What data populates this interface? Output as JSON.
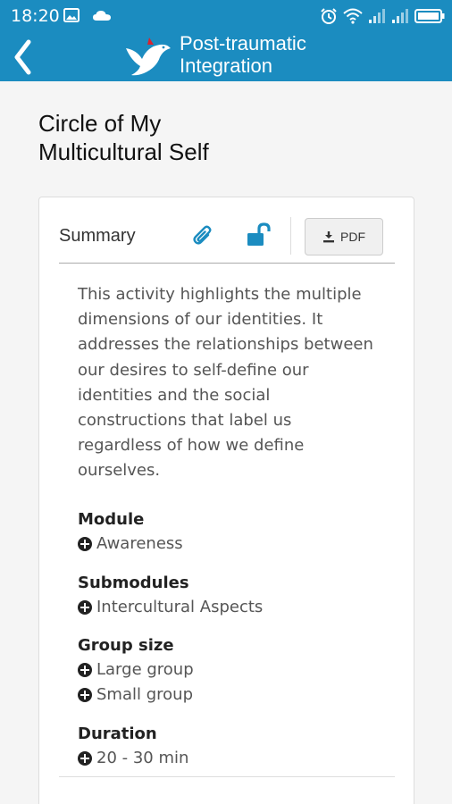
{
  "status_bar": {
    "time": "18:20",
    "icons": [
      "image-icon",
      "cloud-icon",
      "alarm-icon",
      "wifi-icon",
      "signal-icon",
      "signal-icon",
      "battery-icon"
    ]
  },
  "app_header": {
    "brand_line1": "Post-traumatic",
    "brand_line2": "Integration",
    "back_icon": "chevron-left-icon",
    "logo": "bird-logo",
    "color": "#1b8cc0"
  },
  "page": {
    "title_line1": "Circle of My",
    "title_line2": "Multicultural Self"
  },
  "card": {
    "summary_label": "Summary",
    "pdf_label": "PDF",
    "description": "This activity highlights the multiple dimensions of our identities. It addresses the relationships between our desires to self-define our identities and the social constructions that label us regardless of how we define ourselves.",
    "sections": [
      {
        "title": "Module",
        "items": [
          "Awareness"
        ]
      },
      {
        "title": "Submodules",
        "items": [
          "Intercultural Aspects"
        ]
      },
      {
        "title": "Group size",
        "items": [
          "Large group",
          "Small group"
        ]
      },
      {
        "title": "Duration",
        "items": [
          "20 - 30 min"
        ]
      }
    ],
    "accent_color": "#1b8cc0"
  }
}
